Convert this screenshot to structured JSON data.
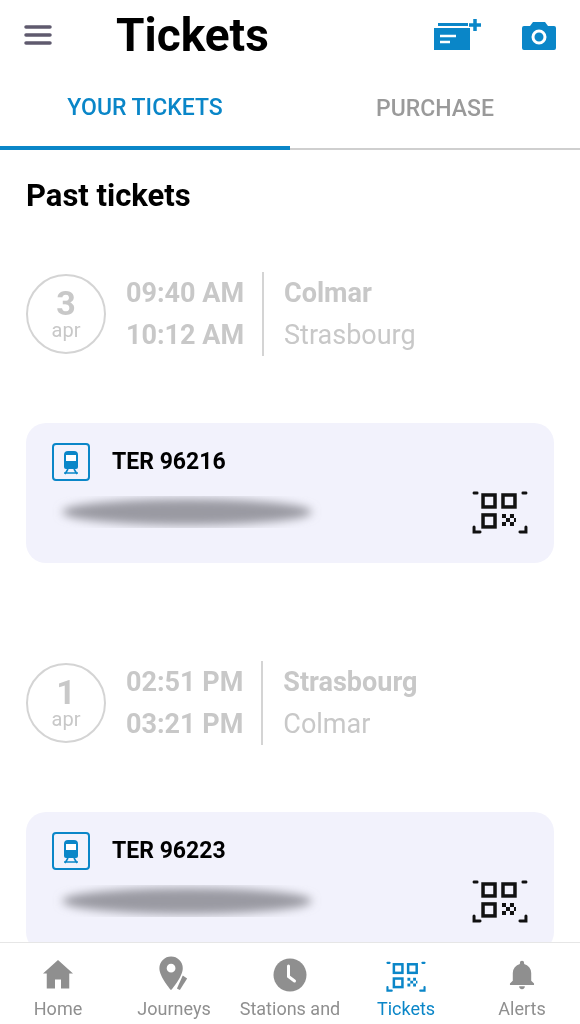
{
  "header": {
    "title": "Tickets"
  },
  "tabs": [
    {
      "label": "YOUR TICKETS",
      "selected": true
    },
    {
      "label": "PURCHASE",
      "selected": false
    }
  ],
  "section_title": "Past tickets",
  "tickets": [
    {
      "day": "3",
      "month": "apr",
      "departure_time": "09:40 AM",
      "arrival_time": "10:12 AM",
      "origin": "Colmar",
      "destination": "Strasbourg",
      "train": "TER 96216"
    },
    {
      "day": "1",
      "month": "apr",
      "departure_time": "02:51 PM",
      "arrival_time": "03:21 PM",
      "origin": "Strasbourg",
      "destination": "Colmar",
      "train": "TER 96223"
    }
  ],
  "nav": [
    {
      "kind": "home",
      "label": "Home",
      "selected": false
    },
    {
      "kind": "journeys",
      "label": "Journeys",
      "selected": false
    },
    {
      "kind": "stations",
      "label": "Stations and",
      "selected": false
    },
    {
      "kind": "tickets",
      "label": "Tickets",
      "selected": true
    },
    {
      "kind": "alerts",
      "label": "Alerts",
      "selected": false
    }
  ]
}
